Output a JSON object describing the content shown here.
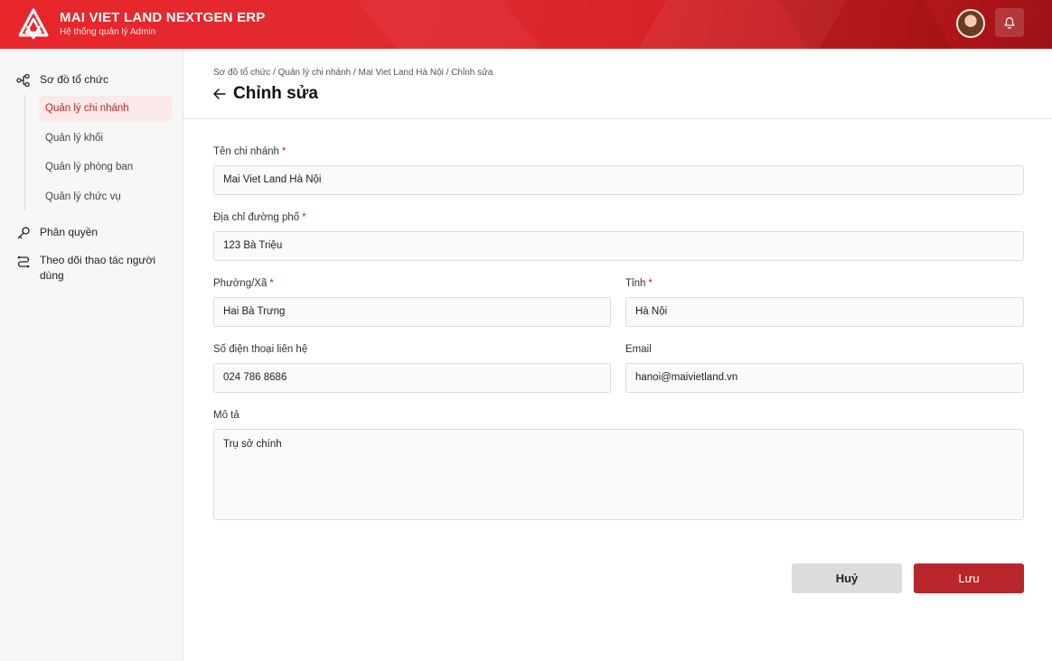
{
  "header": {
    "title": "MAI VIET LAND NEXTGEN ERP",
    "subtitle": "Hệ thống quản lý Admin"
  },
  "sidebar": {
    "groups": [
      {
        "label": "Sơ đồ tổ chức",
        "icon": "org-chart-icon"
      },
      {
        "label": "Phân quyền",
        "icon": "key-icon"
      },
      {
        "label": "Theo dõi thao tác người dùng",
        "icon": "route-icon"
      }
    ],
    "subitems": [
      {
        "label": "Quản lý chi nhánh",
        "active": true
      },
      {
        "label": "Quản lý khối",
        "active": false
      },
      {
        "label": "Quản lý phòng ban",
        "active": false
      },
      {
        "label": "Quản lý chức vụ",
        "active": false
      }
    ]
  },
  "breadcrumb": "Sơ đồ tổ chức / Quản lý chi nhánh / Mai Viet Land Hà Nội / Chỉnh sửa",
  "page_title": "Chỉnh sửa",
  "form": {
    "branch_name": {
      "label": "Tên chi nhánh",
      "required": "*",
      "value": "Mai Viet Land Hà Nội"
    },
    "street": {
      "label": "Địa chỉ đường phố",
      "required": "*",
      "value": "123 Bà Triệu"
    },
    "ward": {
      "label": "Phường/Xã",
      "required": "*",
      "value": "Hai Bà Trưng"
    },
    "province": {
      "label": "Tỉnh",
      "required": "*",
      "value": "Hà Nội"
    },
    "phone": {
      "label": "Số điện thoại liên hệ",
      "value": "024 786 8686"
    },
    "email": {
      "label": "Email",
      "value": "hanoi@maivietland.vn"
    },
    "description": {
      "label": "Mô tả",
      "value": "Trụ sở chính"
    }
  },
  "actions": {
    "cancel": "Huỷ",
    "save": "Lưu"
  },
  "colors": {
    "brand_red": "#e02a2f",
    "save_button": "#b8262b",
    "active_nav_bg": "#fbe9e9",
    "active_nav_text": "#c0262b"
  }
}
